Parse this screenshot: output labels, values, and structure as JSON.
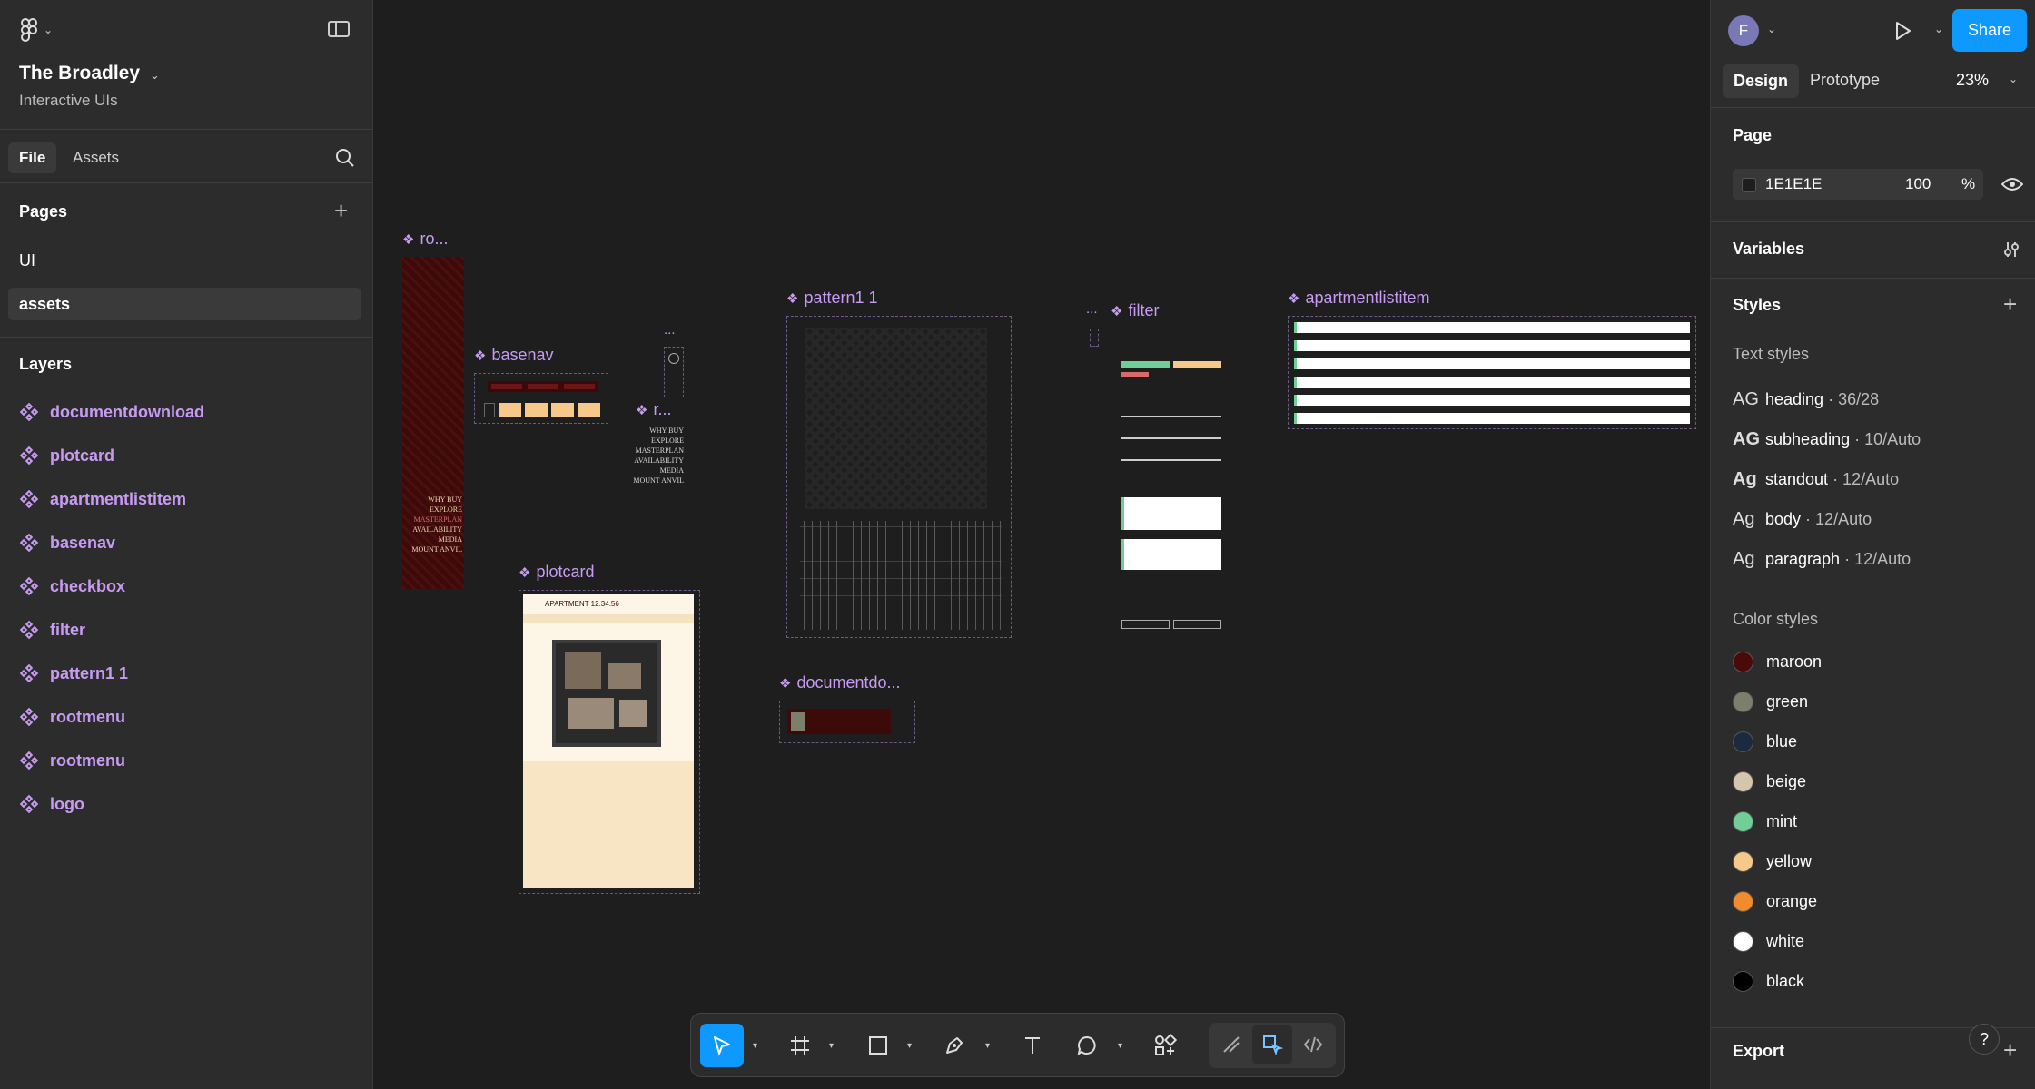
{
  "project": {
    "title": "The Broadley",
    "subtitle": "Interactive UIs"
  },
  "left_tabs": {
    "file": "File",
    "assets": "Assets"
  },
  "pages": {
    "heading": "Pages",
    "items": [
      "UI",
      "assets"
    ],
    "active": "assets"
  },
  "layers": {
    "heading": "Layers",
    "items": [
      "documentdownload",
      "plotcard",
      "apartmentlistitem",
      "basenav",
      "checkbox",
      "filter",
      "pattern1 1",
      "rootmenu",
      "rootmenu",
      "logo"
    ]
  },
  "canvas": {
    "frame_labels": {
      "rootmenu_a": "ro...",
      "basenav": "basenav",
      "ellipsis": "...",
      "rootmenu_b": "r...",
      "pattern": "pattern1 1",
      "filter_ellipsis": "...",
      "filter": "filter",
      "apartmentlistitem": "apartmentlistitem",
      "plotcard": "plotcard",
      "documentdownload": "documentdo..."
    },
    "menu_lines": [
      "WHY BUY",
      "EXPLORE",
      "MASTERPLAN",
      "AVAILABILITY",
      "MEDIA",
      "MOUNT ANVIL"
    ],
    "plotcard_title": "APARTMENT 12.34.56"
  },
  "right": {
    "avatar": "F",
    "share": "Share",
    "tabs": {
      "design": "Design",
      "prototype": "Prototype"
    },
    "zoom": "23%",
    "page": {
      "heading": "Page",
      "fill_hex": "1E1E1E",
      "opacity": "100",
      "pct": "%"
    },
    "variables": "Variables",
    "styles": "Styles",
    "text_styles_heading": "Text styles",
    "text_styles": [
      {
        "ag": "AG",
        "name": "heading",
        "meta": " · 36/28"
      },
      {
        "ag": "AG",
        "name": "subheading",
        "meta": " · 10/Auto"
      },
      {
        "ag": "Ag",
        "name": "standout",
        "meta": " · 12/Auto"
      },
      {
        "ag": "Ag",
        "name": "body",
        "meta": " · 12/Auto"
      },
      {
        "ag": "Ag",
        "name": "paragraph",
        "meta": " · 12/Auto"
      }
    ],
    "color_styles_heading": "Color styles",
    "color_styles": [
      {
        "name": "maroon",
        "hex": "#4a0a0a"
      },
      {
        "name": "green",
        "hex": "#7c806a"
      },
      {
        "name": "blue",
        "hex": "#1c2a3f"
      },
      {
        "name": "beige",
        "hex": "#d6c5ad"
      },
      {
        "name": "mint",
        "hex": "#6fcf97"
      },
      {
        "name": "yellow",
        "hex": "#f6c88a"
      },
      {
        "name": "orange",
        "hex": "#f28a2e"
      },
      {
        "name": "white",
        "hex": "#ffffff"
      },
      {
        "name": "black",
        "hex": "#000000"
      }
    ],
    "export": "Export",
    "help": "?"
  },
  "colors": {
    "accent": "#0d99ff",
    "component": "#c79bf2",
    "canvas_bg": "#1e1e1e",
    "panel_bg": "#2c2c2c"
  }
}
